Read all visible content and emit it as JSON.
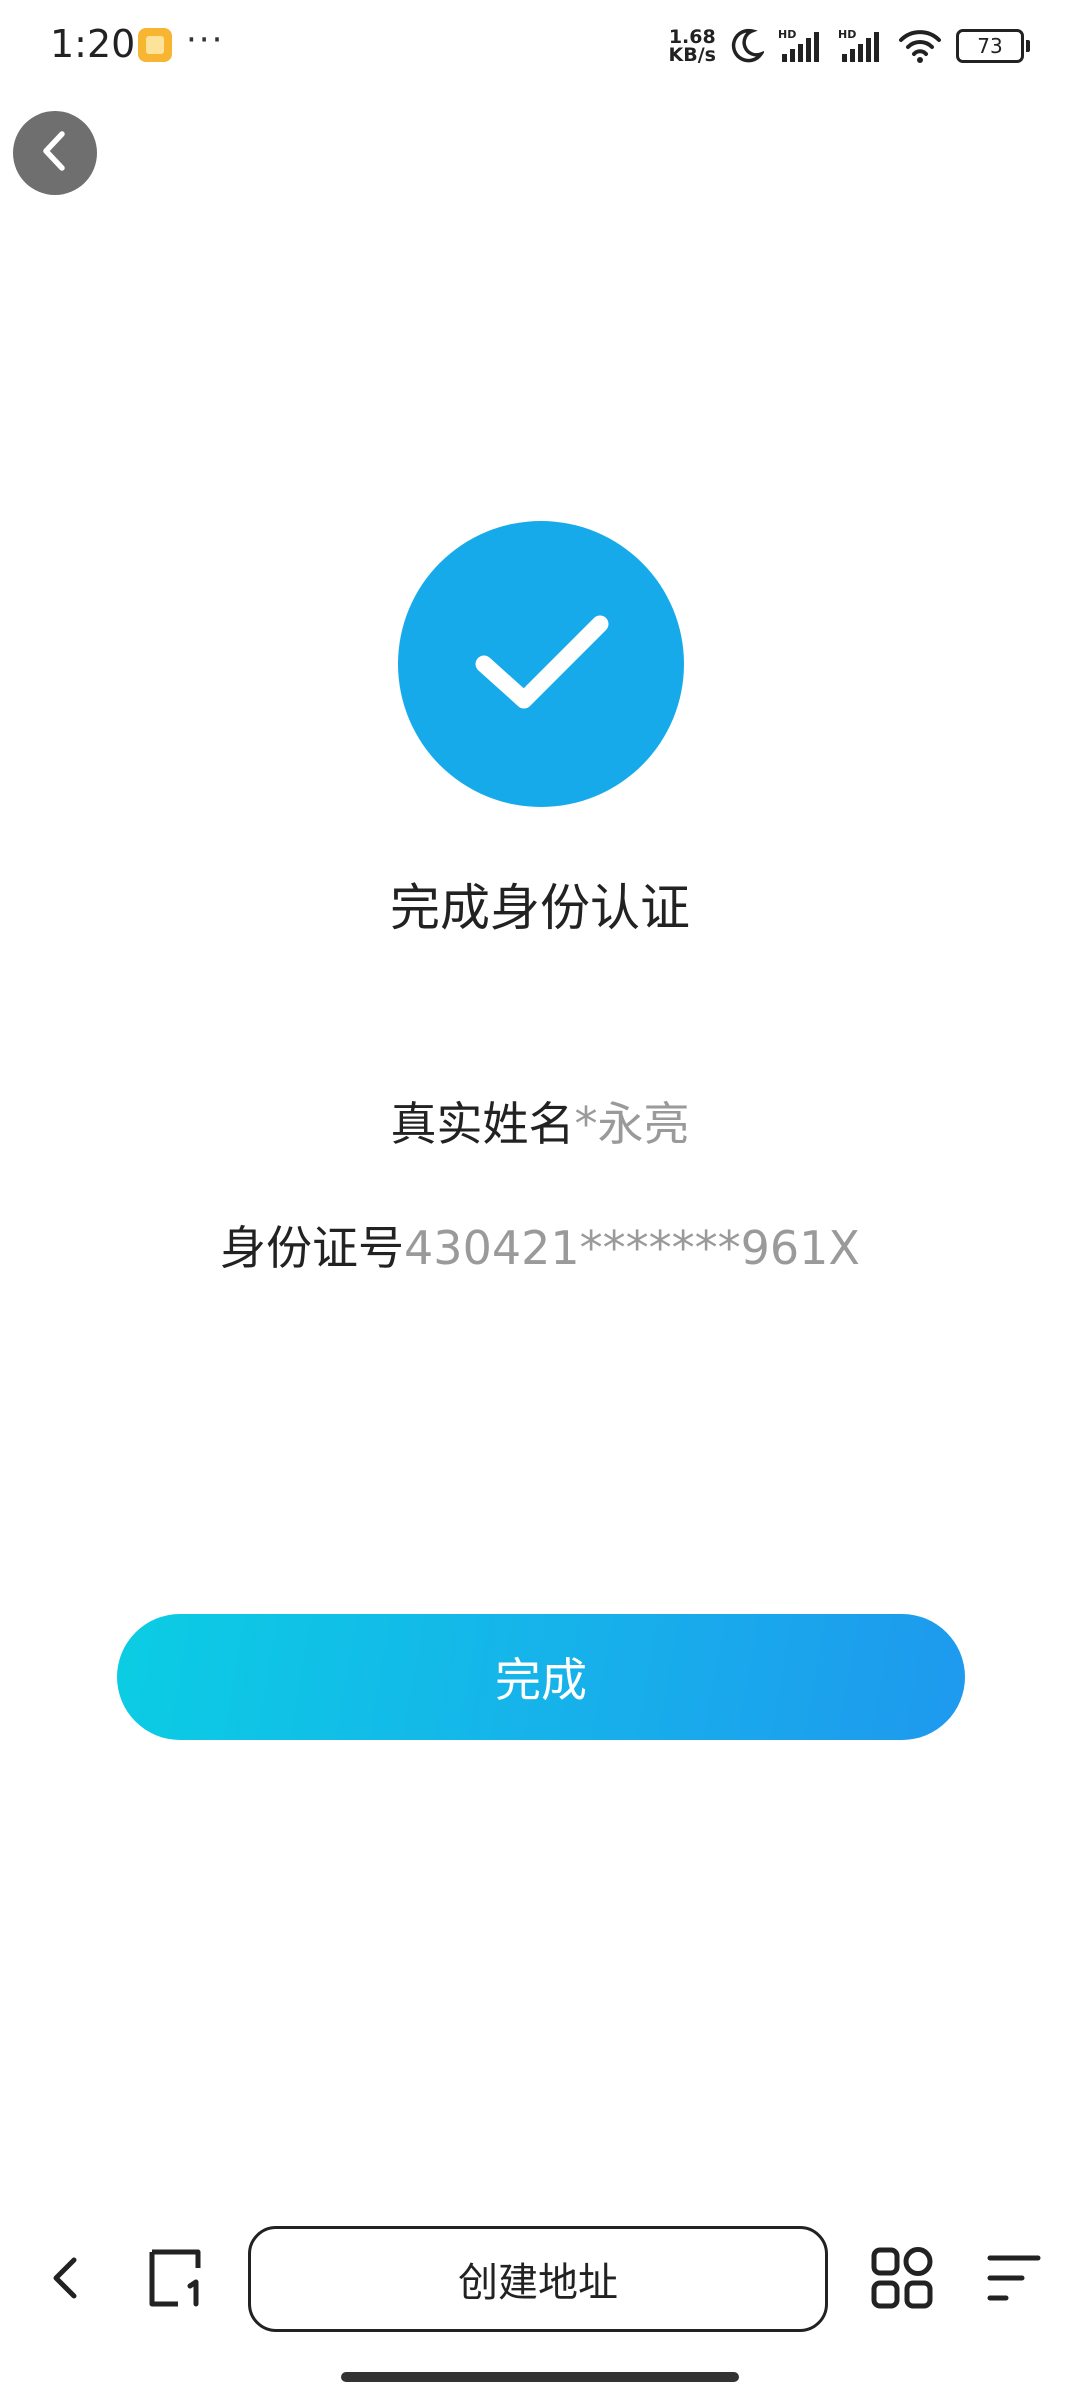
{
  "status_bar": {
    "time": "1:20",
    "more": "···",
    "net_speed_value": "1.68",
    "net_speed_unit": "KB/s",
    "hd_label": "HD",
    "battery": "73"
  },
  "result": {
    "title": "完成身份认证",
    "name_label": "真实姓名",
    "name_value": "*永亮",
    "id_label": "身份证号",
    "id_value": "430421*******961X"
  },
  "actions": {
    "done_label": "完成"
  },
  "browser_bar": {
    "address_label": "创建地址"
  },
  "colors": {
    "accent": "#17aaea",
    "button_start": "#0bcde3",
    "button_end": "#1e99ee",
    "back_button": "#6f6f6f"
  },
  "icons": {
    "back": "chevron-left-icon",
    "success": "checkmark-icon",
    "tabs": "tabs-icon",
    "apps": "grid-icon",
    "menu": "menu-icon"
  }
}
